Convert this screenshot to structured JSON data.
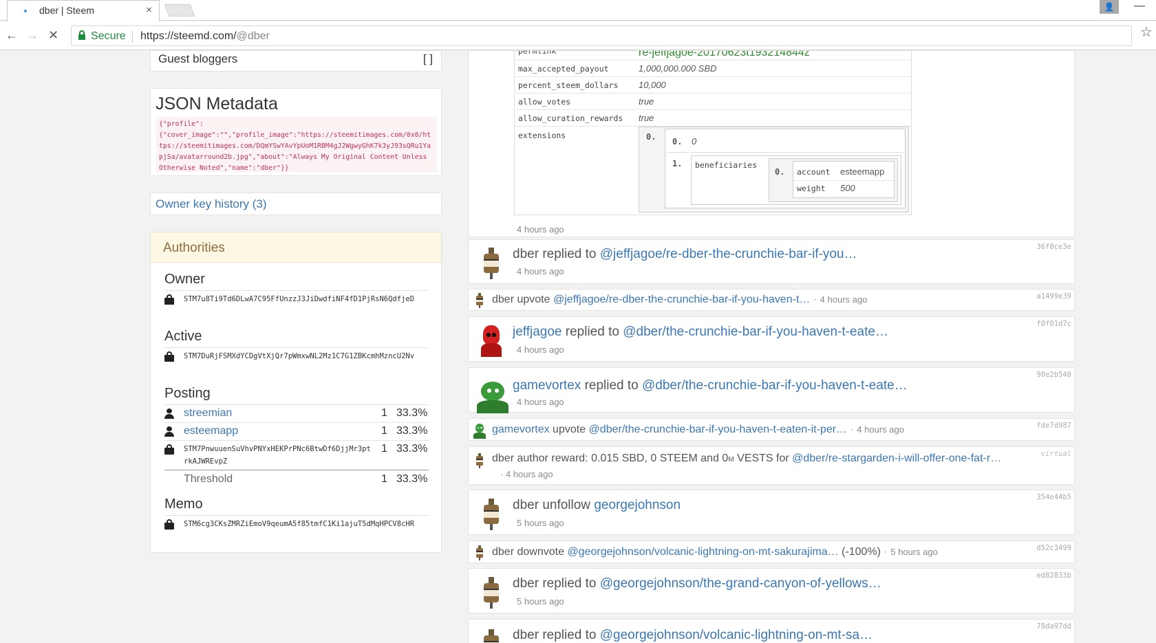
{
  "browser": {
    "tab_title": "dber | Steem",
    "tab_close": "×",
    "secure_label": "Secure",
    "url_main": "https://steemd.com/",
    "url_path": "@dber"
  },
  "left": {
    "guest": {
      "label": "Guest bloggers",
      "value": "[ ]"
    },
    "json": {
      "title": "JSON Metadata",
      "content": "{\"profile\":\n{\"cover_image\":\"\",\"profile_image\":\"https://steemitimages.com/0x0/https://steemitimages.com/DQmYSwYAvYpUoM1RBM4gJ2WgwyGhK7k3yJ93sQRu1YapjSa/avatarround2b.jpg\",\"about\":\"Always My Original Content Unless Otherwise Noted\",\"name\":\"dber\"}}"
    },
    "owner_key_history": "Owner key history (3)",
    "authorities": {
      "title": "Authorities",
      "owner": {
        "label": "Owner",
        "key": "STM7u8Ti9Td6DLwA7C95FfUnzzJ3JiDwdfiNF4fD1PjRsN6QdfjeD"
      },
      "active": {
        "label": "Active",
        "key": "STM7DuRjFSMXdYCDgVtXjQr7pWmxwNL2Mz1C7G1ZBKcmhMzncU2Nv"
      },
      "posting": {
        "label": "Posting",
        "accounts": [
          {
            "name": "streemian",
            "weight": "1",
            "pct": "33.3%"
          },
          {
            "name": "esteemapp",
            "weight": "1",
            "pct": "33.3%"
          }
        ],
        "key": {
          "value": "STM7PnwuuenSuVhvPNYxHEKPrPNc6BtwDf6DjjMr3ptrkAJWREvpZ",
          "weight": "1",
          "pct": "33.3%"
        },
        "threshold": {
          "label": "Threshold",
          "weight": "1",
          "pct": "33.3%"
        }
      },
      "memo": {
        "label": "Memo",
        "key": "STM6cg3CKsZMRZiEmoV9qeumA5f85tmfC1Ki1ajuT5dMqHPCV8cHR"
      }
    }
  },
  "topcard": {
    "permlink_key": "permlink",
    "permlink_value": "re-jeffjagoe-20170623t193214844z",
    "rows": [
      {
        "key": "max_accepted_payout",
        "value": "1,000,000.000 SBD"
      },
      {
        "key": "percent_steem_dollars",
        "value": "10,000"
      },
      {
        "key": "allow_votes",
        "value": "true"
      },
      {
        "key": "allow_curation_rewards",
        "value": "true"
      }
    ],
    "extensions": {
      "key": "extensions",
      "idx0": "0.",
      "inner0_idx": "0.",
      "inner0_val": "0",
      "inner1_idx": "1.",
      "beneficiaries": "beneficiaries",
      "ben_idx": "0.",
      "account_key": "account",
      "account_val": "esteemapp",
      "weight_key": "weight",
      "weight_val": "500"
    },
    "time": "4 hours ago"
  },
  "ops": [
    {
      "user": "dber",
      "action": "replied to",
      "target": "@jeffjagoe/re-dber-the-crunchie-bar-if-you…",
      "time": "4 hours ago",
      "hash": "36f0ce3e"
    },
    {
      "user": "dber",
      "action": "upvote",
      "target": "@jeffjagoe/re-dber-the-crunchie-bar-if-you-haven-t…",
      "time": "4 hours ago",
      "hash": "a1499e39"
    },
    {
      "user": "jeffjagoe",
      "action": "replied to",
      "target": "@dber/the-crunchie-bar-if-you-haven-t-eate…",
      "time": "4 hours ago",
      "hash": "f0f01d7c"
    },
    {
      "user": "gamevortex",
      "action": "replied to",
      "target": "@dber/the-crunchie-bar-if-you-haven-t-eate…",
      "time": "4 hours ago",
      "hash": "90e2b540"
    },
    {
      "user": "gamevortex",
      "action": "upvote",
      "target": "@dber/the-crunchie-bar-if-you-haven-t-eaten-it-per…",
      "time": "4 hours ago",
      "hash": "fde7d987"
    },
    {
      "user": "dber",
      "action": "author reward: 0.015 SBD, 0 STEEM and 0",
      "vests_unit": "M",
      "action_tail": " VESTS for",
      "target": "@dber/re-stargarden-i-will-offer-one-fat-r…",
      "time": "4 hours ago",
      "hash": "virtual"
    },
    {
      "user": "dber",
      "action": "unfollow",
      "target": "georgejohnson",
      "time": "5 hours ago",
      "hash": "354e44b5"
    },
    {
      "user": "dber",
      "action": "downvote",
      "target": "@georgejohnson/volcanic-lightning-on-mt-sakurajima…",
      "extra": "(-100%)",
      "time": "5 hours ago",
      "hash": "d52c3499"
    },
    {
      "user": "dber",
      "action": "replied to",
      "target": "@georgejohnson/the-grand-canyon-of-yellows…",
      "time": "5 hours ago",
      "hash": "ed82833b"
    },
    {
      "user": "dber",
      "action": "replied to",
      "target": "@georgejohnson/volcanic-lightning-on-mt-sa…",
      "time": "",
      "hash": "78da97dd"
    }
  ]
}
